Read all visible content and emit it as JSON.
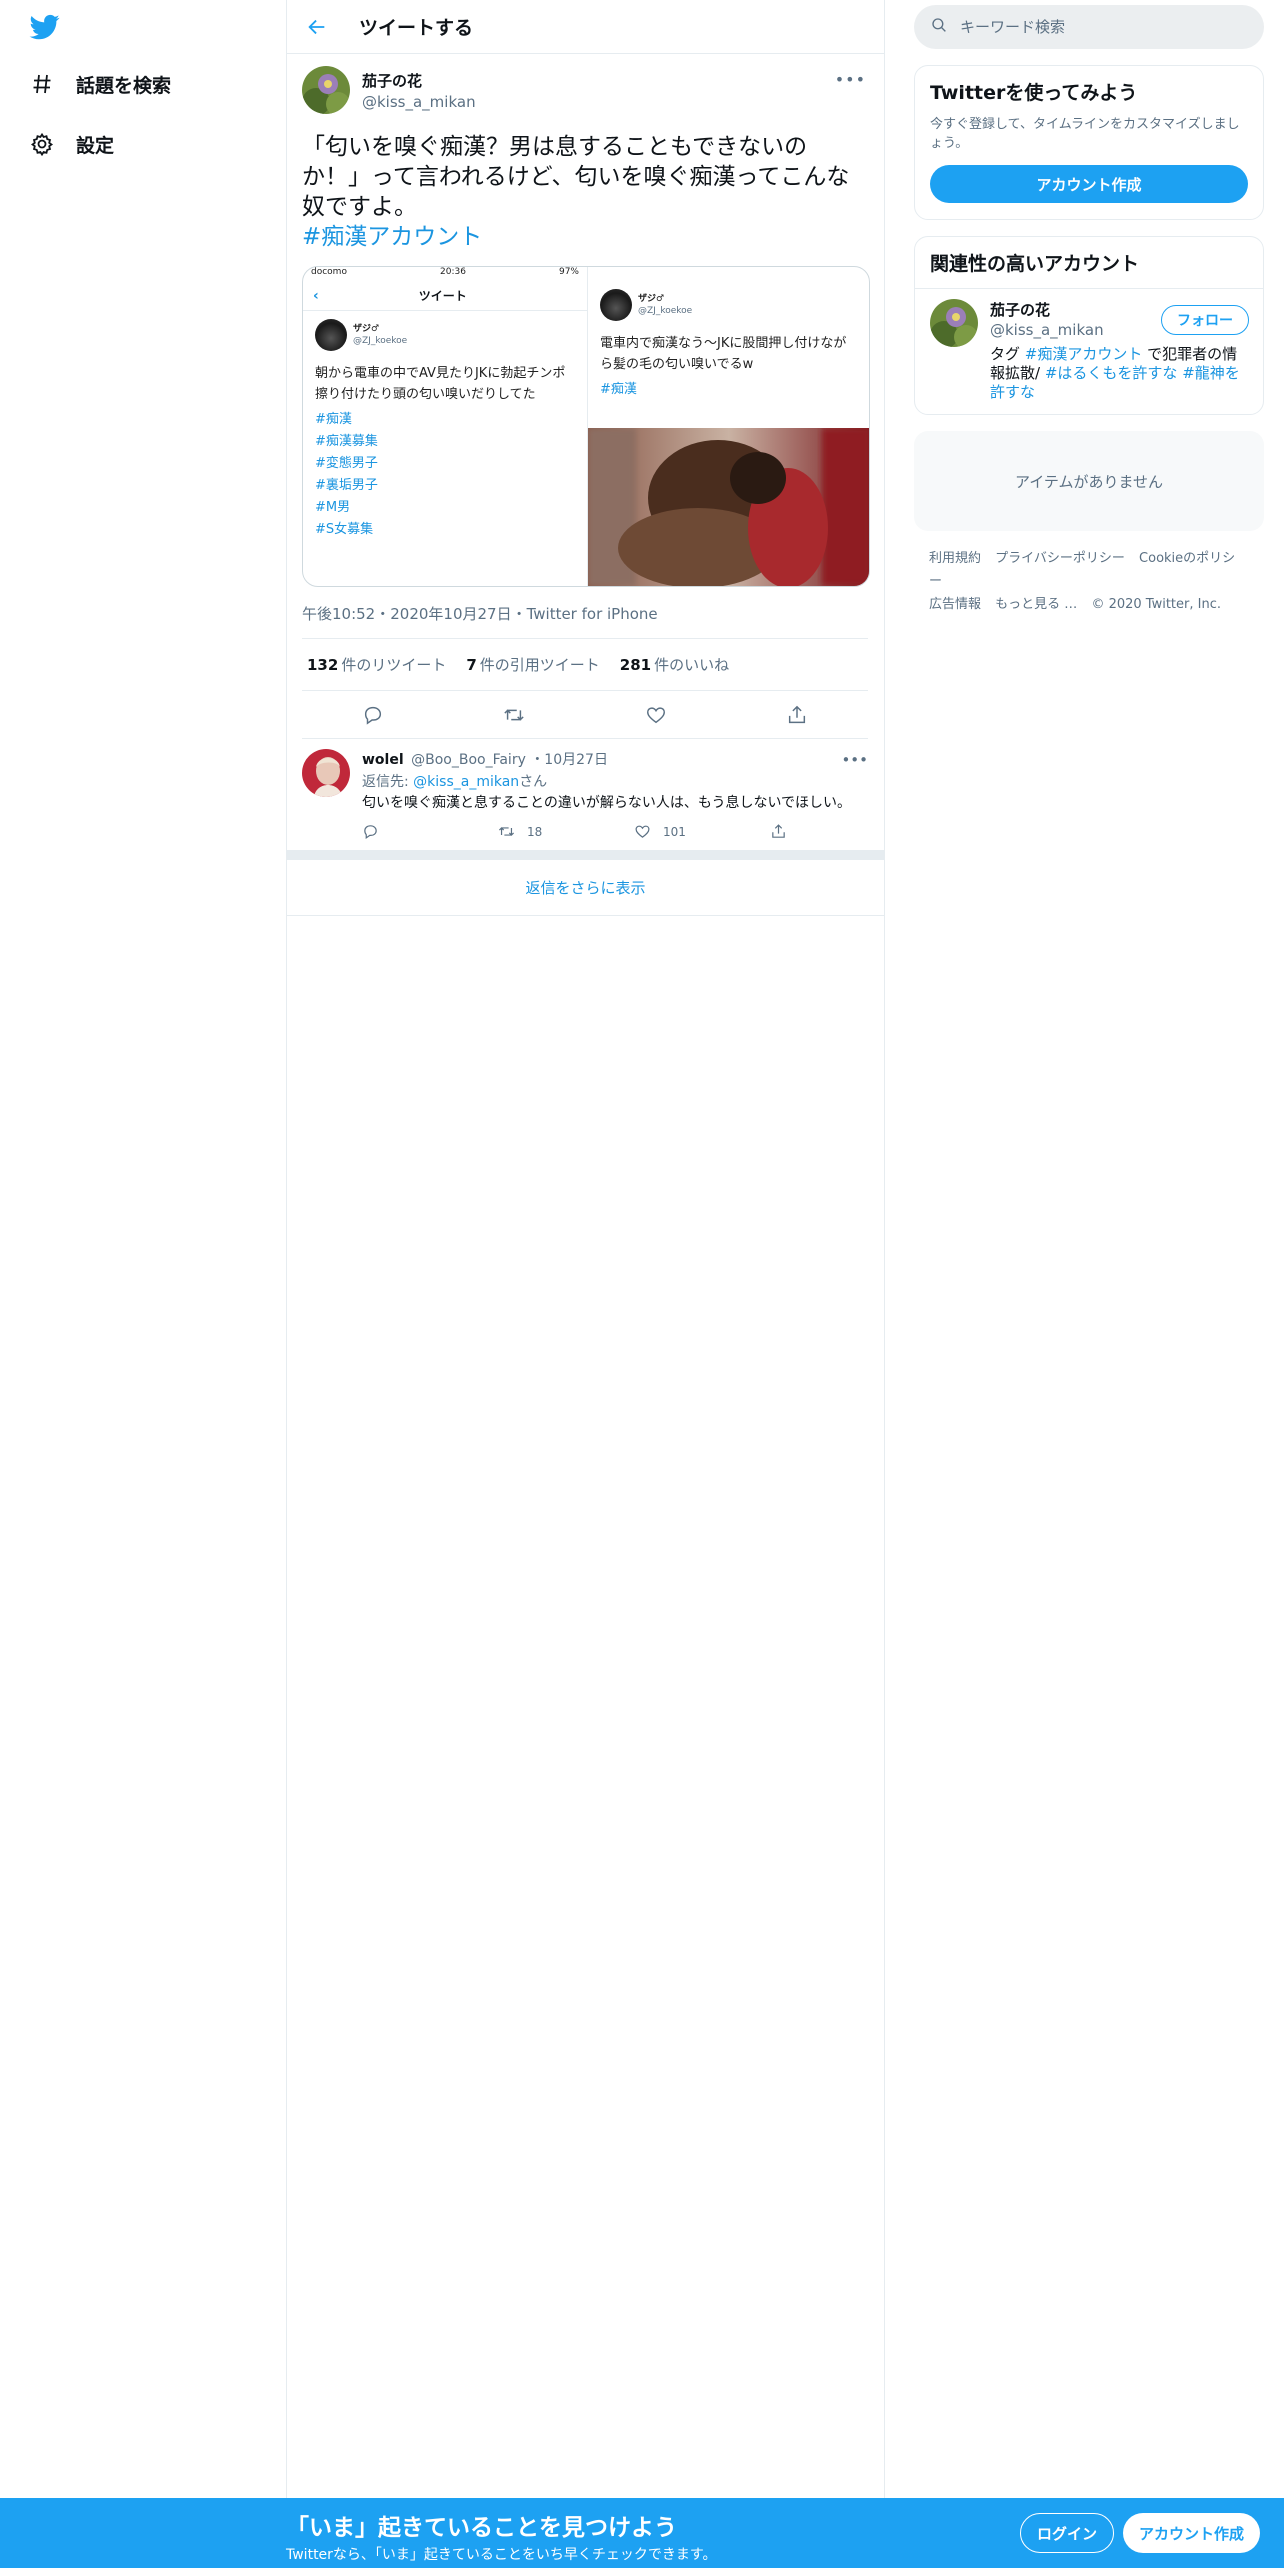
{
  "sidebar": {
    "logo": "twitter-bird-icon",
    "items": [
      {
        "icon": "hashtag-icon",
        "label": "話題を検索"
      },
      {
        "icon": "gear-icon",
        "label": "設定"
      }
    ]
  },
  "header": {
    "title": "ツイートする"
  },
  "tweet": {
    "name": "茄子の花",
    "handle": "@kiss_a_mikan",
    "text": "「匂いを嗅ぐ痴漢？男は息することもできないのか！」って言われるけど、匂いを嗅ぐ痴漢ってこんな奴ですよ。",
    "hashtag": "#痴漢アカウント",
    "info": "午後10:52・2020年10月27日・Twitter for iPhone",
    "stats": {
      "retweets": "132",
      "retweets_label": "件のリツイート",
      "quotes": "7",
      "quotes_label": "件の引用ツイート",
      "likes": "281",
      "likes_label": "件のいいね"
    },
    "media": {
      "left": {
        "status_carrier": "docomo",
        "status_time": "20:36",
        "status_battery": "97%",
        "header": "ツイート",
        "name": "ザジ♂",
        "handle": "@ZJ_koekoe",
        "text": "朝から電車の中でAV見たりJKに勃起チンポ擦り付けたり頭の匂い嗅いだりしてた",
        "tags": [
          "#痴漢",
          "#痴漢募集",
          "#変態男子",
          "#裏垢男子",
          "#M男",
          "#S女募集"
        ]
      },
      "right": {
        "name": "ザジ♂",
        "handle": "@ZJ_koekoe",
        "text": "電車内で痴漢なう〜JKに股間押し付けながら髪の毛の匂い嗅いでるw",
        "tag": "#痴漢"
      }
    }
  },
  "reply": {
    "name": "wolel",
    "handle": "@Boo_Boo_Fairy",
    "date": "・10月27日",
    "reply_to_prefix": "返信先: ",
    "reply_to_mention": "@kiss_a_mikan",
    "reply_to_suffix": "さん",
    "text": "匂いを嗅ぐ痴漢と息することの違いが解らない人は、もう息しないでほしい。",
    "retweets": "18",
    "likes": "101"
  },
  "show_more": "返信をさらに表示",
  "right": {
    "search_placeholder": "キーワード検索",
    "signup": {
      "title": "Twitterを使ってみよう",
      "subtitle": "今すぐ登録して、タイムラインをカスタマイズしましょう。",
      "button": "アカウント作成"
    },
    "related": {
      "title": "関連性の高いアカウント",
      "name": "茄子の花",
      "handle": "@kiss_a_mikan",
      "follow": "フォロー",
      "bio_1": "タグ ",
      "bio_tag1": "#痴漢アカウント",
      "bio_2": " で犯罪者の情報拡散/ ",
      "bio_tag2": "#はるくもを許すな",
      "bio_3": " ",
      "bio_tag3": "#龍神を許すな"
    },
    "trends_empty": "アイテムがありません",
    "footer": [
      "利用規約",
      "プライバシーポリシー",
      "Cookieのポリシー",
      "広告情報",
      "もっと見る …",
      "© 2020 Twitter, Inc."
    ]
  },
  "bottom_bar": {
    "title": "「いま」起きていることを見つけよう",
    "subtitle": "Twitterなら、「いま」起きていることをいち早くチェックできます。",
    "login": "ログイン",
    "signup": "アカウント作成"
  },
  "colors": {
    "accent": "#1da1f2",
    "link": "#1b95e0",
    "muted": "#5b7083",
    "border": "#e6ecf0"
  }
}
